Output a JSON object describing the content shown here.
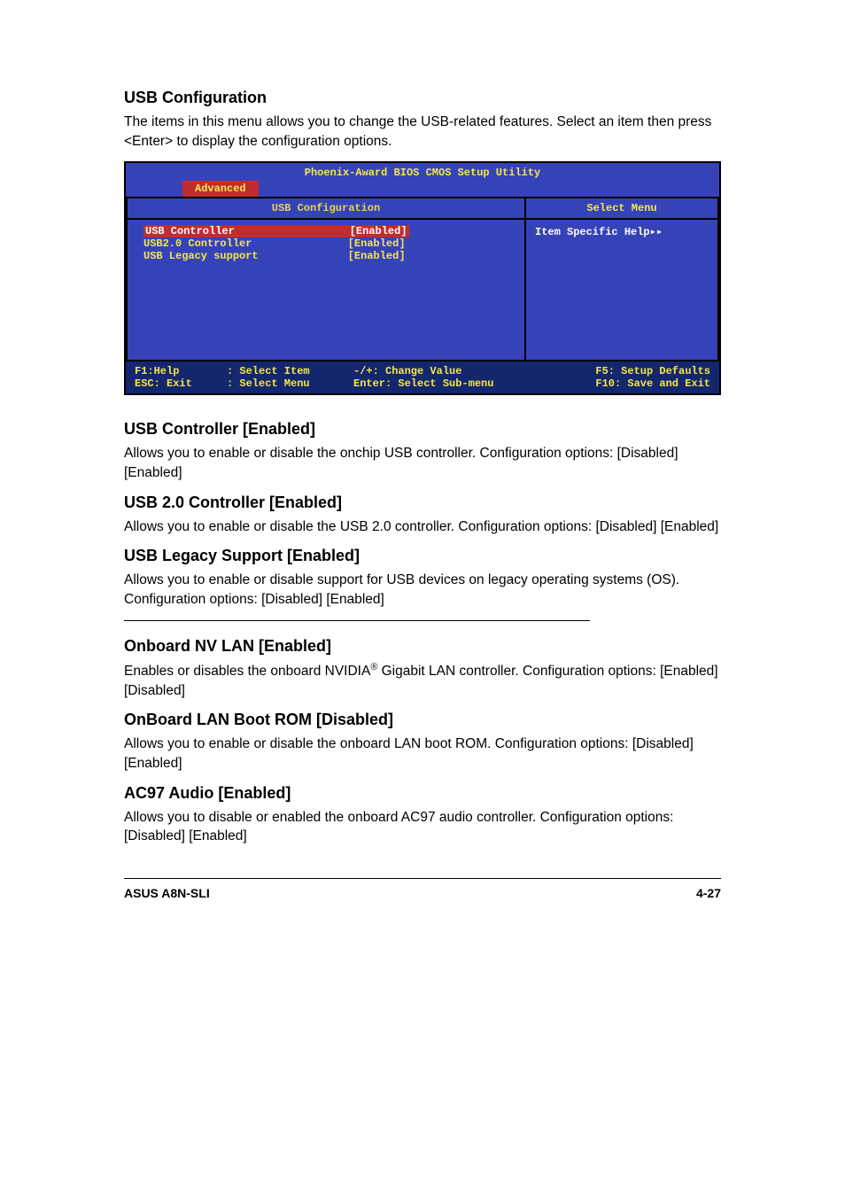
{
  "h_usb_config": "USB Configuration",
  "p_usb_config": "The items in this menu allows you to change the USB-related features. Select an item then press <Enter> to display the configuration options.",
  "bios": {
    "title": "Phoenix-Award BIOS CMOS Setup Utility",
    "tab": "Advanced",
    "left_head": "USB Configuration",
    "right_head": "Select Menu",
    "help": "Item Specific Help",
    "items": [
      {
        "label": "USB Controller",
        "value": "[Enabled]"
      },
      {
        "label": "USB2.0 Controller",
        "value": "[Enabled]"
      },
      {
        "label": "USB Legacy support",
        "value": "[Enabled]"
      }
    ],
    "footer": {
      "f1": "F1:Help",
      "esc": "ESC: Exit",
      "sel_item": ": Select Item",
      "sel_menu": ": Select Menu",
      "change": "-/+: Change Value",
      "enter": "Enter: Select Sub-menu",
      "f5": "F5: Setup Defaults",
      "f10": "F10: Save and Exit"
    }
  },
  "h_usb_ctrl": "USB Controller [Enabled]",
  "p_usb_ctrl": "Allows you to enable or disable the onchip USB controller. Configuration options: [Disabled] [Enabled]",
  "h_usb20": "USB 2.0 Controller [Enabled]",
  "p_usb20": "Allows you to enable or disable the USB 2.0 controller. Configuration options: [Disabled] [Enabled]",
  "h_legacy": "USB Legacy Support [Enabled]",
  "p_legacy": "Allows you to enable or disable support for USB devices on legacy operating systems (OS). Configuration options: [Disabled] [Enabled]",
  "h_nvlan": "Onboard NV LAN [Enabled]",
  "p_nvlan_a": "Enables or disables the onboard NVIDIA",
  "p_nvlan_b": " Gigabit LAN controller. Configuration options: [Enabled] [Disabled]",
  "h_bootrom": "OnBoard LAN Boot ROM [Disabled]",
  "p_bootrom": "Allows you to enable or disable the onboard LAN boot ROM. Configuration options: [Disabled] [Enabled]",
  "h_ac97": "AC97 Audio [Enabled]",
  "p_ac97": "Allows you to disable or enabled  the onboard AC97 audio controller. Configuration options: [Disabled] [Enabled]",
  "footer_left": "ASUS A8N-SLI",
  "footer_right": "4-27",
  "reg_mark": "®"
}
